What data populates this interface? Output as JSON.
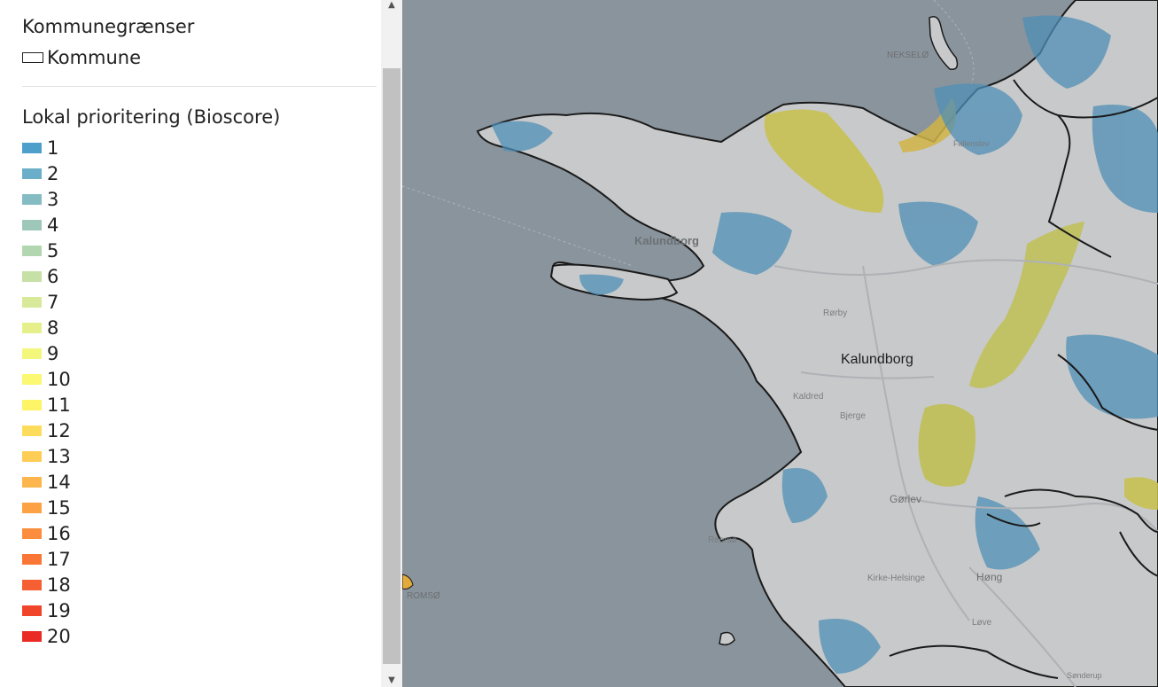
{
  "legend": {
    "municipal_title": "Kommunegrænser",
    "municipal_item": "Kommune",
    "bioscore_title": "Lokal prioritering (Bioscore)",
    "bioscore_items": [
      {
        "label": "1",
        "color": "#4f9fcb"
      },
      {
        "label": "2",
        "color": "#6aaec9"
      },
      {
        "label": "3",
        "color": "#85bcc4"
      },
      {
        "label": "4",
        "color": "#9dc8b9"
      },
      {
        "label": "5",
        "color": "#b2d6b0"
      },
      {
        "label": "6",
        "color": "#c6e0a5"
      },
      {
        "label": "7",
        "color": "#d8ea99"
      },
      {
        "label": "8",
        "color": "#e6f08a"
      },
      {
        "label": "9",
        "color": "#f3f77c"
      },
      {
        "label": "10",
        "color": "#fbf871"
      },
      {
        "label": "11",
        "color": "#fdf466"
      },
      {
        "label": "12",
        "color": "#fddc5c"
      },
      {
        "label": "13",
        "color": "#fdcd55"
      },
      {
        "label": "14",
        "color": "#fdb64d"
      },
      {
        "label": "15",
        "color": "#fda244"
      },
      {
        "label": "16",
        "color": "#fc8d3e"
      },
      {
        "label": "17",
        "color": "#f97637"
      },
      {
        "label": "18",
        "color": "#f55f31"
      },
      {
        "label": "19",
        "color": "#f0452b"
      },
      {
        "label": "20",
        "color": "#ea2a25"
      }
    ]
  },
  "map": {
    "sea_color": "#8a949c",
    "land_color": "#c8c9ca",
    "labels": {
      "nekselo": "NEKSELØ",
      "kalundborg_small": "Kalundborg",
      "kalundborg": "Kalundborg",
      "rorby": "Rørby",
      "bjerge": "Bjerge",
      "kaldred": "Kaldred",
      "gorlev": "Gørlev",
      "reersø": "Reersø",
      "kirke_helsinge": "Kirke-Helsinge",
      "hong": "Høng",
      "leve": "Løve",
      "romso": "ROMSØ",
      "fallenslev": "Fallenslev",
      "sonderup": "Sønderup"
    }
  }
}
